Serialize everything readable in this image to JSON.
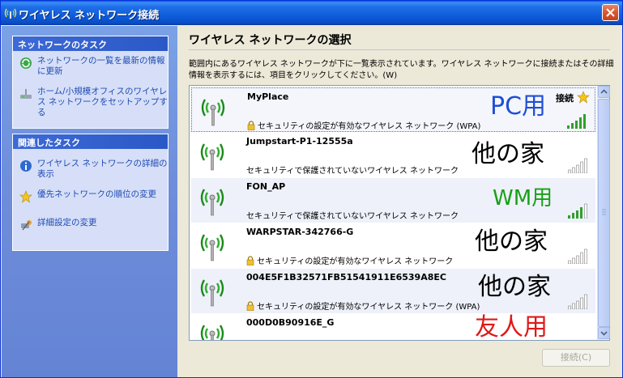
{
  "window": {
    "title": "ワイヤレス ネットワーク接続"
  },
  "sidebar": {
    "network_tasks": {
      "header": "ネットワークのタスク",
      "items": [
        {
          "label": "ネットワークの一覧を最新の情報に更新",
          "icon": "refresh-icon"
        },
        {
          "label": "ホーム/小規模オフィスのワイヤレス ネットワークをセットアップする",
          "icon": "setup-icon"
        }
      ]
    },
    "related_tasks": {
      "header": "関連したタスク",
      "items": [
        {
          "label": "ワイヤレス ネットワークの詳細の表示",
          "icon": "info-icon"
        },
        {
          "label": "優先ネットワークの順位の変更",
          "icon": "star-icon"
        },
        {
          "label": "詳細設定の変更",
          "icon": "settings-icon"
        }
      ]
    }
  },
  "main": {
    "heading": "ワイヤレス ネットワークの選択",
    "description": "範囲内にあるワイヤレス ネットワークが下に一覧表示されています。ワイヤレス ネットワークに接続またはその詳細情報を表示するには、項目をクリックしてください。(W)",
    "networks": [
      {
        "ssid": "MyPlace",
        "security": "セキュリティの設定が有効なワイヤレス ネットワーク (WPA)",
        "status": "接続",
        "note": "PC用",
        "note_color": "#1e4fd6"
      },
      {
        "ssid": "Jumpstart-P1-12555a",
        "security": "セキュリティで保護されていないワイヤレス ネットワーク",
        "note": "他の家",
        "note_color": "#000000"
      },
      {
        "ssid": "FON_AP",
        "security": "セキュリティで保護されていないワイヤレス ネットワーク",
        "note": "WM用",
        "note_color": "#18a018"
      },
      {
        "ssid": "WARPSTAR-342766-G",
        "security": "セキュリティの設定が有効なワイヤレス ネットワーク",
        "note": "他の家",
        "note_color": "#000000"
      },
      {
        "ssid": "004E5F1B32571FB51541911E6539A8EC",
        "security": "セキュリティの設定が有効なワイヤレス ネットワーク (WPA)",
        "note": "他の家",
        "note_color": "#000000"
      },
      {
        "ssid": "000D0B90916E_G",
        "security": "",
        "note": "友人用",
        "note_color": "#e01818"
      }
    ],
    "connect_button": "接続(C)"
  }
}
